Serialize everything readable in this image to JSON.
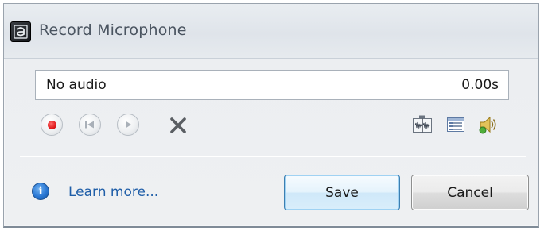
{
  "window": {
    "title": "Record Microphone",
    "app_icon": "app-logo-icon"
  },
  "audio": {
    "status": "No audio",
    "duration": "0.00s"
  },
  "controls": [
    {
      "name": "record",
      "icon": "record-icon"
    },
    {
      "name": "rewind",
      "icon": "rewind-icon"
    },
    {
      "name": "play",
      "icon": "play-icon"
    },
    {
      "name": "delete",
      "icon": "close-x-icon"
    }
  ],
  "tools": [
    {
      "name": "waveform",
      "icon": "waveform-icon"
    },
    {
      "name": "list",
      "icon": "list-icon"
    },
    {
      "name": "speaker",
      "icon": "speaker-icon"
    }
  ],
  "footer": {
    "learn_more": "Learn more...",
    "save_label": "Save",
    "cancel_label": "Cancel"
  },
  "colors": {
    "link": "#1f5ea8",
    "record_red": "#e0191b",
    "info_blue": "#2a78d4",
    "save_border": "#3c7fb1"
  }
}
